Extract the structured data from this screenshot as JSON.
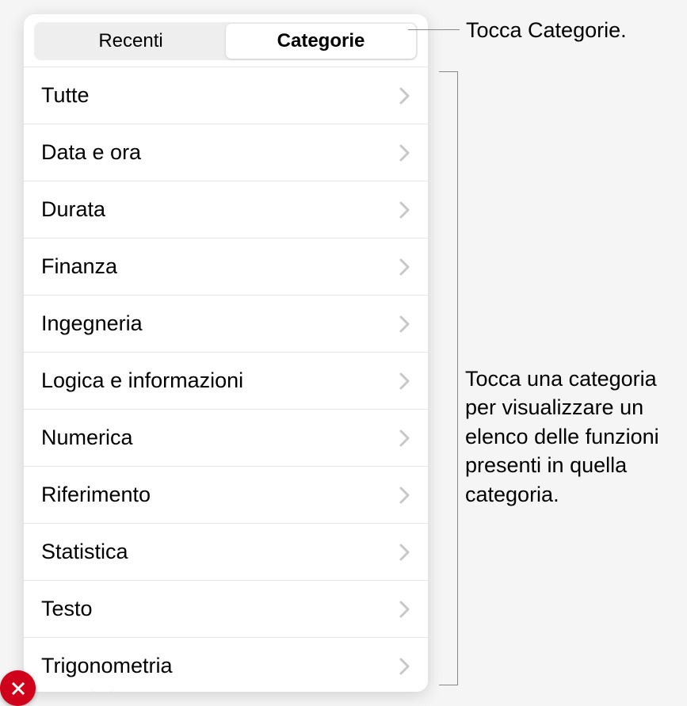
{
  "segmented": {
    "recent_label": "Recenti",
    "categories_label": "Categorie"
  },
  "categories": [
    {
      "label": "Tutte"
    },
    {
      "label": "Data e ora"
    },
    {
      "label": "Durata"
    },
    {
      "label": "Finanza"
    },
    {
      "label": "Ingegneria"
    },
    {
      "label": "Logica e informazioni"
    },
    {
      "label": "Numerica"
    },
    {
      "label": "Riferimento"
    },
    {
      "label": "Statistica"
    },
    {
      "label": "Testo"
    },
    {
      "label": "Trigonometria"
    }
  ],
  "callouts": {
    "top": "Tocca Categorie.",
    "mid": "Tocca una categoria per visualizzare un elenco delle funzioni presenti in quella categoria."
  }
}
